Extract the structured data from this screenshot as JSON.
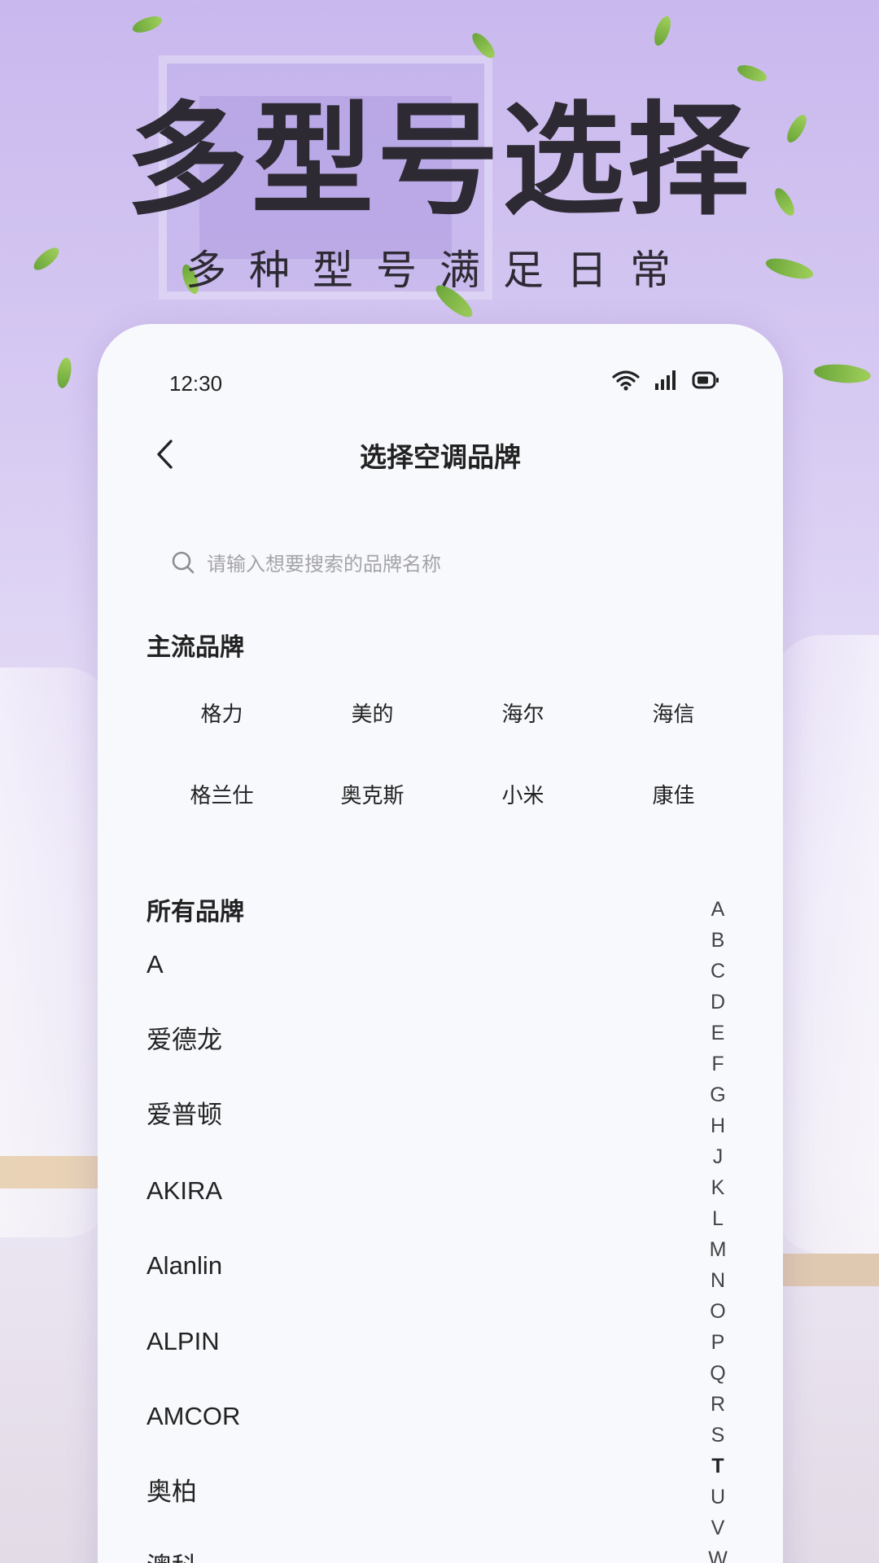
{
  "hero": {
    "title": "多型号选择",
    "subtitle": "多种型号满足日常"
  },
  "status_bar": {
    "time": "12:30",
    "icons": [
      "wifi-icon",
      "signal-icon",
      "battery-icon"
    ]
  },
  "nav": {
    "title": "选择空调品牌",
    "back_icon": "chevron-left-icon"
  },
  "search": {
    "placeholder": "请输入想要搜索的品牌名称",
    "value": ""
  },
  "popular": {
    "title": "主流品牌",
    "brands": [
      "格力",
      "美的",
      "海尔",
      "海信",
      "格兰仕",
      "奥克斯",
      "小米",
      "康佳"
    ]
  },
  "all_brands": {
    "title": "所有品牌",
    "items": [
      "A",
      "爱德龙",
      "爱普顿",
      "AKIRA",
      "Alanlin",
      "ALPIN",
      "AMCOR",
      "奥柏",
      "澳科"
    ]
  },
  "index_bar": {
    "letters": [
      "A",
      "B",
      "C",
      "D",
      "E",
      "F",
      "G",
      "H",
      "J",
      "K",
      "L",
      "M",
      "N",
      "O",
      "P",
      "Q",
      "R",
      "S",
      "T",
      "U",
      "V",
      "W"
    ],
    "active": "T"
  },
  "colors": {
    "background_top": "#c9b8ee",
    "card": "#f8f9fd",
    "text": "#222222",
    "placeholder": "#a4a4a8"
  }
}
